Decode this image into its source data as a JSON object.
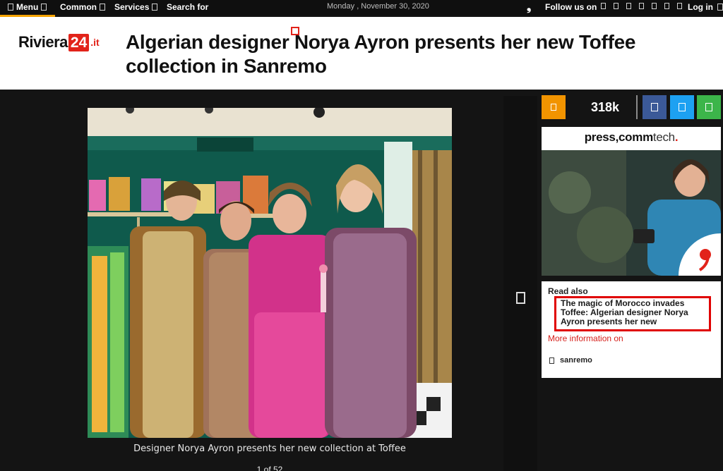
{
  "topbar": {
    "menu_label": "Menu",
    "common_label": "Common",
    "services_label": "Services",
    "search_label": "Search for",
    "date": "Monday , November 30, 2020",
    "follow_label": "Follow us on",
    "login_label": "Log in"
  },
  "header": {
    "logo_text": "Riviera",
    "logo_number": "24",
    "logo_tld": ".it",
    "headline": "Algerian designer Norya Ayron presents her new Toffee collection in Sanremo"
  },
  "gallery": {
    "caption": "Designer Norya Ayron presents her new collection at Toffee",
    "pager": "1 of 52"
  },
  "sidebar": {
    "share_count": "318k",
    "colors": {
      "rss": "#f29400",
      "facebook": "#3b5998",
      "twitter": "#1da1f2",
      "whatsapp": "#3cb54a"
    },
    "ad": {
      "brand_bold": "press,",
      "brand_mid": "comm",
      "brand_light": "tech",
      "brand_dot": "."
    },
    "read_also_title": "Read also",
    "read_also_link": "The magic of Morocco invades Toffee: Algerian designer Norya Ayron presents her new",
    "more_info": "More information on",
    "tag": "sanremo"
  }
}
